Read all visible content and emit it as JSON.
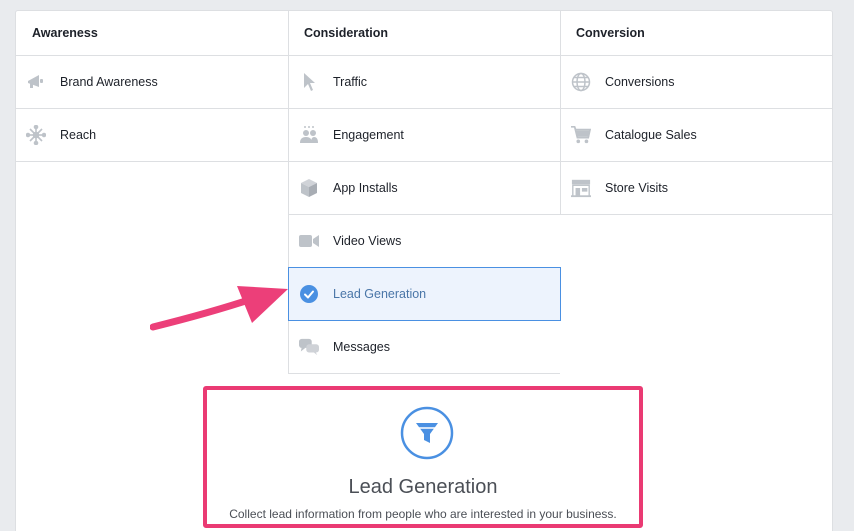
{
  "columns": [
    {
      "header": "Awareness",
      "items": [
        {
          "label": "Brand Awareness",
          "icon": "megaphone-icon"
        },
        {
          "label": "Reach",
          "icon": "reach-icon"
        }
      ]
    },
    {
      "header": "Consideration",
      "items": [
        {
          "label": "Traffic",
          "icon": "cursor-icon"
        },
        {
          "label": "Engagement",
          "icon": "people-icon"
        },
        {
          "label": "App Installs",
          "icon": "box-icon"
        },
        {
          "label": "Video Views",
          "icon": "video-camera-icon"
        },
        {
          "label": "Lead Generation",
          "icon": "check-circle-icon",
          "selected": true
        },
        {
          "label": "Messages",
          "icon": "chat-bubbles-icon"
        }
      ]
    },
    {
      "header": "Conversion",
      "items": [
        {
          "label": "Conversions",
          "icon": "globe-icon"
        },
        {
          "label": "Catalogue Sales",
          "icon": "shopping-cart-icon"
        },
        {
          "label": "Store Visits",
          "icon": "store-icon"
        }
      ]
    }
  ],
  "detail": {
    "title": "Lead Generation",
    "description": "Collect lead information from people who are interested in your business.",
    "icon": "funnel-icon"
  },
  "colors": {
    "accent": "#4a90e2",
    "highlight": "#ea3a73",
    "icon_gray": "#bec3c9"
  }
}
